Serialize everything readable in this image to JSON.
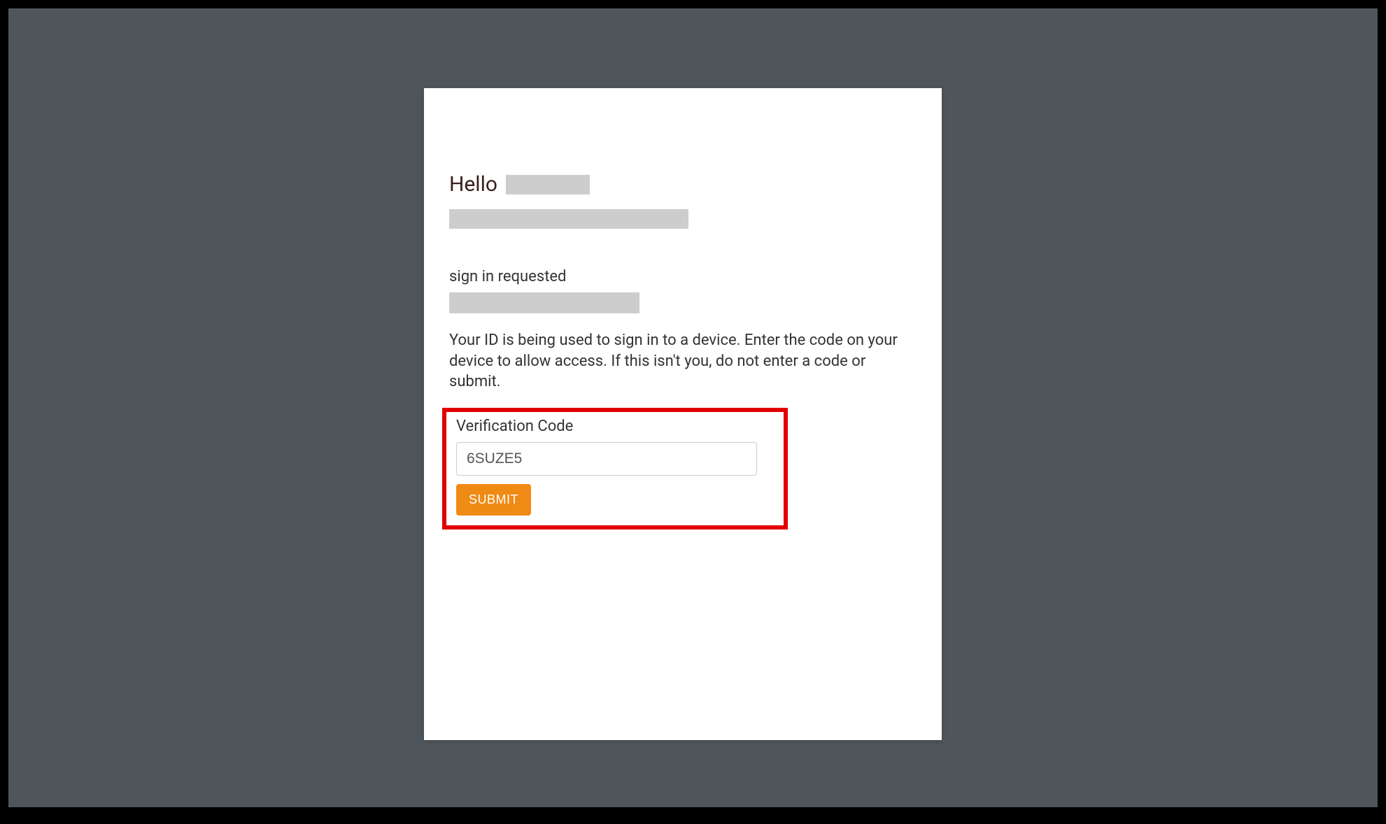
{
  "greeting": {
    "hello": "Hello"
  },
  "signin": {
    "requested_label": "sign in requested",
    "instruction": "Your ID is being used to sign in to a device. Enter the code on your device to allow access. If this isn't you, do not enter a code or submit."
  },
  "verification": {
    "label": "Verification Code",
    "value": "6SUZE5",
    "submit_label": "SUBMIT"
  },
  "colors": {
    "accent": "#ef8a14",
    "highlight_border": "#e10000",
    "background": "#4f565b",
    "redacted": "#cdcdcd"
  }
}
